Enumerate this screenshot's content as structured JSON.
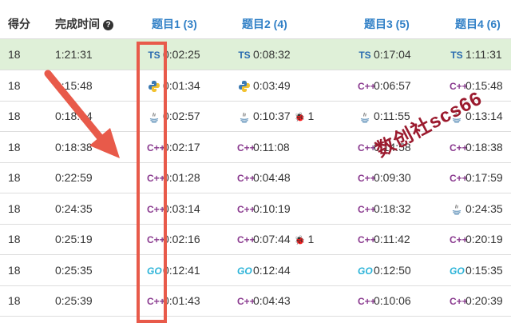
{
  "header": {
    "score": "得分",
    "time": "完成时间",
    "help_icon": "?",
    "problems": [
      "题目1 (3)",
      "题目2 (4)",
      "题目3 (5)",
      "题目4 (6)"
    ]
  },
  "rows": [
    {
      "score": "18",
      "time": "1:21:31",
      "cells": [
        {
          "lang": "ts",
          "time": "0:02:25"
        },
        {
          "lang": "ts",
          "time": "0:08:32"
        },
        {
          "lang": "ts",
          "time": "0:17:04"
        },
        {
          "lang": "ts",
          "time": "1:11:31"
        }
      ]
    },
    {
      "score": "18",
      "time": "0:15:48",
      "cells": [
        {
          "lang": "py",
          "time": "0:01:34"
        },
        {
          "lang": "py",
          "time": "0:03:49"
        },
        {
          "lang": "cpp",
          "time": "0:06:57"
        },
        {
          "lang": "cpp",
          "time": "0:15:48"
        }
      ]
    },
    {
      "score": "18",
      "time": "0:18:14",
      "cells": [
        {
          "lang": "java",
          "time": "0:02:57"
        },
        {
          "lang": "java",
          "time": "0:10:37",
          "bug": "1"
        },
        {
          "lang": "java",
          "time": "0:11:55"
        },
        {
          "lang": "java",
          "time": "0:13:14"
        }
      ]
    },
    {
      "score": "18",
      "time": "0:18:38",
      "cells": [
        {
          "lang": "cpp",
          "time": "0:02:17"
        },
        {
          "lang": "cpp",
          "time": "0:11:08"
        },
        {
          "lang": "cpp",
          "time": "0:14:58"
        },
        {
          "lang": "cpp",
          "time": "0:18:38"
        }
      ]
    },
    {
      "score": "18",
      "time": "0:22:59",
      "cells": [
        {
          "lang": "cpp",
          "time": "0:01:28"
        },
        {
          "lang": "cpp",
          "time": "0:04:48"
        },
        {
          "lang": "cpp",
          "time": "0:09:30"
        },
        {
          "lang": "cpp",
          "time": "0:17:59"
        }
      ]
    },
    {
      "score": "18",
      "time": "0:24:35",
      "cells": [
        {
          "lang": "cpp",
          "time": "0:03:14"
        },
        {
          "lang": "cpp",
          "time": "0:10:19"
        },
        {
          "lang": "cpp",
          "time": "0:18:32"
        },
        {
          "lang": "java",
          "time": "0:24:35"
        }
      ]
    },
    {
      "score": "18",
      "time": "0:25:19",
      "cells": [
        {
          "lang": "cpp",
          "time": "0:02:16"
        },
        {
          "lang": "cpp",
          "time": "0:07:44",
          "bug": "1"
        },
        {
          "lang": "cpp",
          "time": "0:11:42"
        },
        {
          "lang": "cpp",
          "time": "0:20:19"
        }
      ]
    },
    {
      "score": "18",
      "time": "0:25:35",
      "cells": [
        {
          "lang": "go",
          "time": "0:12:41"
        },
        {
          "lang": "go",
          "time": "0:12:44"
        },
        {
          "lang": "go",
          "time": "0:12:50"
        },
        {
          "lang": "go",
          "time": "0:15:35"
        }
      ]
    },
    {
      "score": "18",
      "time": "0:25:39",
      "cells": [
        {
          "lang": "cpp",
          "time": "0:01:43"
        },
        {
          "lang": "cpp",
          "time": "0:04:43"
        },
        {
          "lang": "cpp",
          "time": "0:10:06"
        },
        {
          "lang": "cpp",
          "time": "0:20:39"
        }
      ]
    }
  ],
  "lang_labels": {
    "ts": "TS",
    "cpp": "C++",
    "go": "GO"
  },
  "watermark": "数创社scs66",
  "colors": {
    "highlight_row": "#dff0d8",
    "problem_header": "#2f7fc6",
    "annotation_red": "#e85a4a"
  }
}
